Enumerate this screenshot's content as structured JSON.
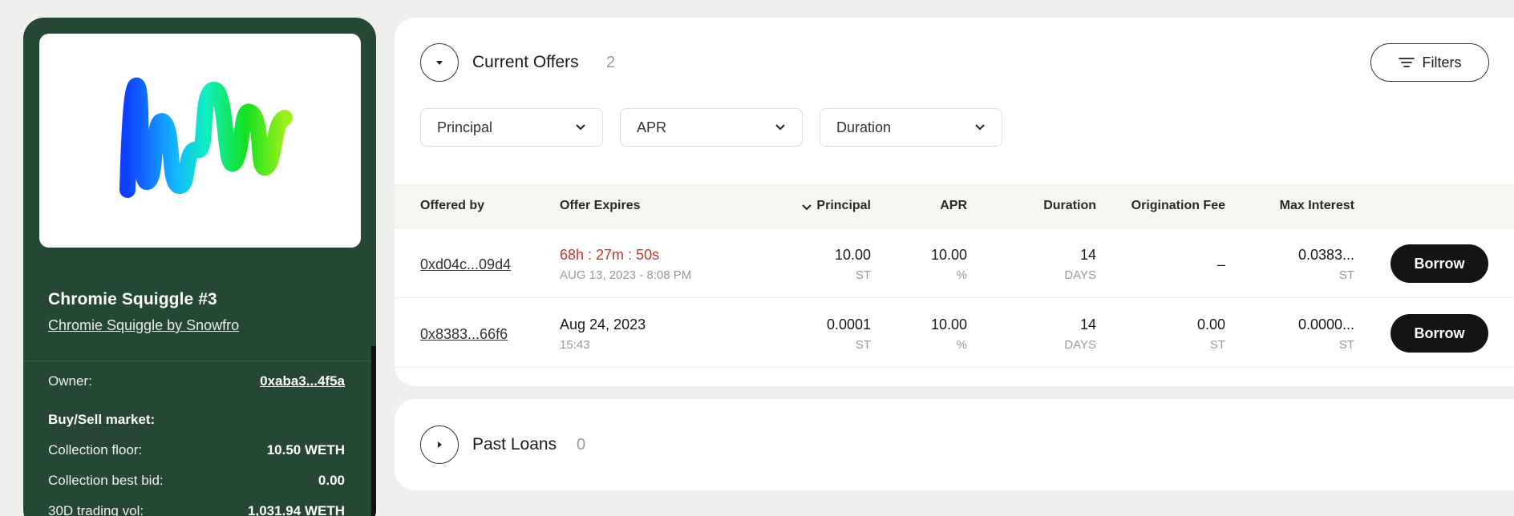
{
  "nft": {
    "title": "Chromie Squiggle #3",
    "collection": "Chromie Squiggle by Snowfro",
    "owner_label": "Owner:",
    "owner_value": "0xaba3...4f5a",
    "market_heading": "Buy/Sell market:",
    "floor_label": "Collection floor:",
    "floor_value": "10.50 WETH",
    "best_bid_label": "Collection best bid:",
    "best_bid_value": "0.00",
    "volume_label": "30D trading vol:",
    "volume_value": "1,031.94 WETH"
  },
  "offers": {
    "title": "Current Offers",
    "count": "2",
    "filters_label": "Filters",
    "dropdowns": [
      "Principal",
      "APR",
      "Duration"
    ],
    "columns": {
      "offered_by": "Offered by",
      "offer_expires": "Offer Expires",
      "principal": "Principal",
      "apr": "APR",
      "duration": "Duration",
      "origination_fee": "Origination Fee",
      "max_interest": "Max Interest"
    },
    "rows": [
      {
        "offered_by": "0xd04c...09d4",
        "expires_main": "68h : 27m : 50s",
        "expires_sub": "AUG 13, 2023 - 8:08 PM",
        "principal": "10.00",
        "principal_unit": "ST",
        "apr": "10.00",
        "apr_unit": "%",
        "duration": "14",
        "duration_unit": "DAYS",
        "origination_fee": "–",
        "origination_fee_unit": "",
        "max_interest": "0.0383...",
        "max_interest_unit": "ST",
        "action": "Borrow"
      },
      {
        "offered_by": "0x8383...66f6",
        "expires_main": "Aug 24, 2023",
        "expires_sub": "15:43",
        "principal": "0.0001",
        "principal_unit": "ST",
        "apr": "10.00",
        "apr_unit": "%",
        "duration": "14",
        "duration_unit": "DAYS",
        "origination_fee": "0.00",
        "origination_fee_unit": "ST",
        "max_interest": "0.0000...",
        "max_interest_unit": "ST",
        "action": "Borrow"
      }
    ]
  },
  "past_loans": {
    "title": "Past Loans",
    "count": "0"
  },
  "colors": {
    "card_bg": "#254734",
    "expires_red": "#c0392b",
    "button_dark": "#141414"
  }
}
